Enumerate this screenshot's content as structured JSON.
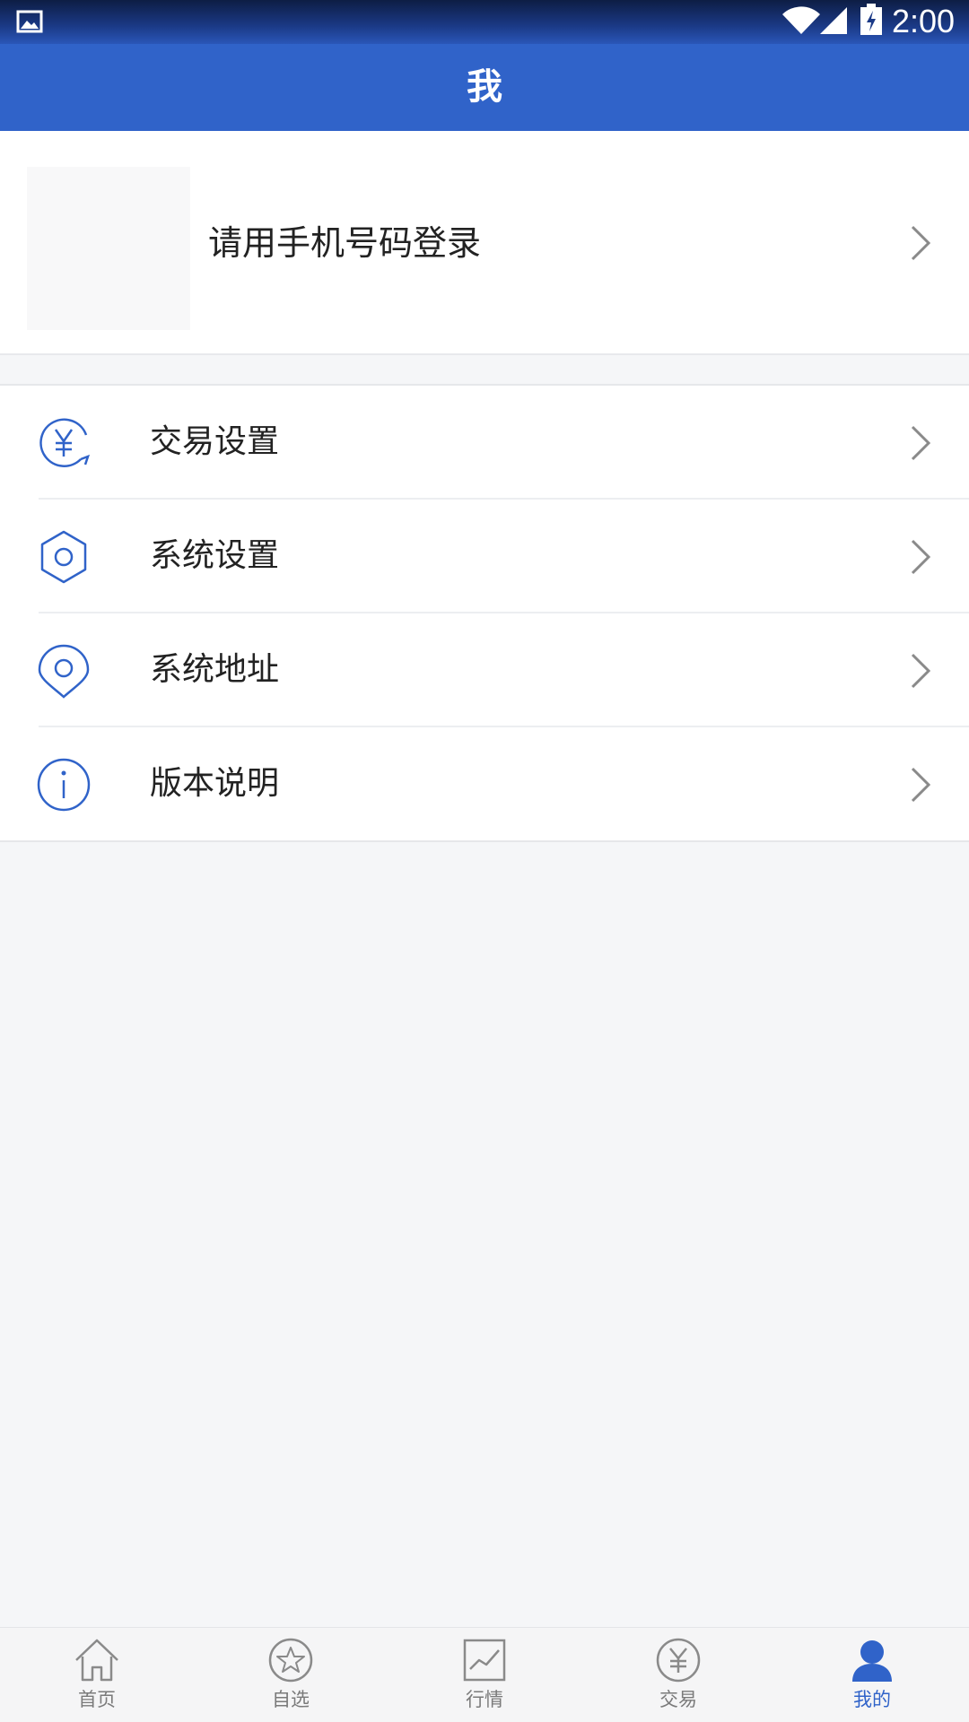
{
  "status_bar": {
    "time": "2:00",
    "icons": [
      "gallery-icon",
      "wifi-icon",
      "signal-icon",
      "battery-charging-icon"
    ]
  },
  "header": {
    "title": "我"
  },
  "profile": {
    "login_label": "请用手机号码登录",
    "icons": [
      "avatar-placeholder",
      "chevron-right-icon"
    ]
  },
  "menu": {
    "items": [
      {
        "label": "交易设置",
        "icon": "yuan-exchange-icon"
      },
      {
        "label": "系统设置",
        "icon": "gear-icon"
      },
      {
        "label": "系统地址",
        "icon": "location-pin-icon"
      },
      {
        "label": "版本说明",
        "icon": "info-icon"
      }
    ]
  },
  "tab_bar": {
    "tabs": [
      {
        "label": "首页",
        "icon": "home-icon",
        "active": false
      },
      {
        "label": "自选",
        "icon": "star-circle-icon",
        "active": false
      },
      {
        "label": "行情",
        "icon": "chart-line-icon",
        "active": false
      },
      {
        "label": "交易",
        "icon": "yuan-circle-icon",
        "active": false
      },
      {
        "label": "我的",
        "icon": "user-icon",
        "active": true
      }
    ]
  },
  "colors": {
    "primary": "#3063c9",
    "background": "#f5f6f8",
    "tab_inactive": "#7a7a7a",
    "chevron": "#8a8a8a"
  }
}
